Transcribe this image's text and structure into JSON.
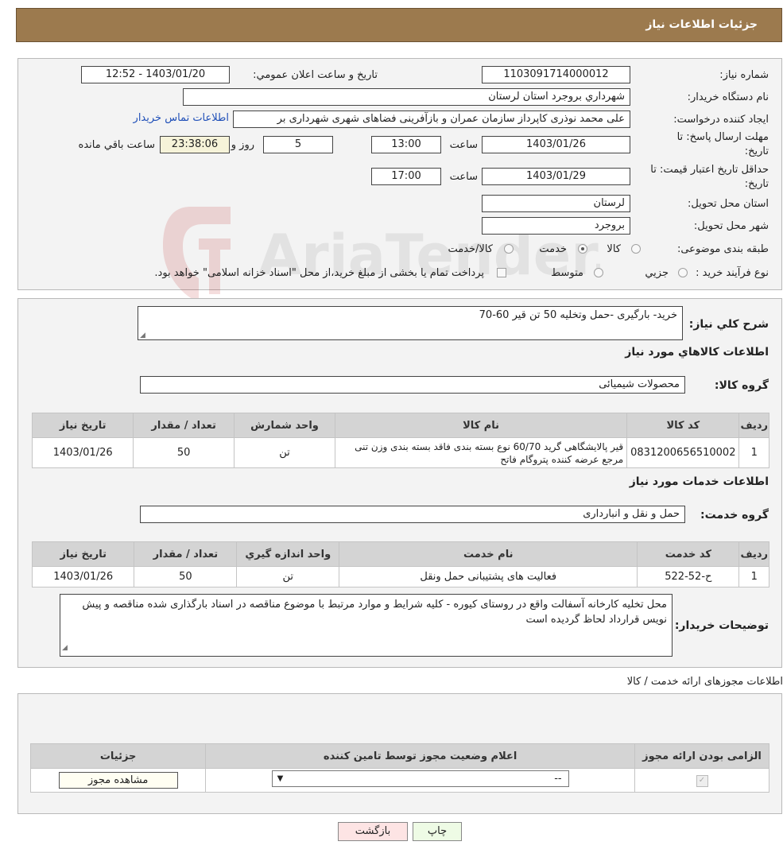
{
  "header": {
    "title": "جزئیات اطلاعات نیاز"
  },
  "need": {
    "number_label": "شماره نیاز:",
    "number": "1103091714000012",
    "announce_label": "تاریخ و ساعت اعلان عمومي:",
    "announce": "1403/01/20 - 12:52",
    "buyer_org_label": "نام دستگاه خريدار:",
    "buyer_org": "شهرداري بروجرد استان لرستان",
    "creator_label": "ايجاد کننده درخواست:",
    "creator": "علی محمد نوذری کاپرداز سازمان عمران و بازآفرینی فضاهای شهری شهرداری بر",
    "contact_link": "اطلاعات تماس خريدار",
    "reply_deadline_label_1": "مهلت ارسال پاسخ: تا",
    "reply_deadline_label_2": "تاريخ:",
    "reply_date": "1403/01/26",
    "hour_label": "ساعت",
    "reply_time": "13:00",
    "days": "5",
    "days_label": "روز و",
    "remaining": "23:38:06",
    "remaining_label": "ساعت باقي مانده",
    "price_validity_label_1": "حداقل تاريخ اعتبار قيمت: تا",
    "price_validity_label_2": "تاريخ:",
    "price_date": "1403/01/29",
    "price_time": "17:00",
    "province_label": "استان محل تحويل:",
    "province": "لرستان",
    "city_label": "شهر محل تحويل:",
    "city": "بروجرد",
    "category_label": "طبقه بندی موضوعی:",
    "category_options": [
      "کالا",
      "خدمت",
      "کالا/خدمت"
    ],
    "process_label": "نوع فرآيند خريد :",
    "process_options": [
      "جزيي",
      "متوسط"
    ],
    "process_note": "پرداخت تمام يا بخشی از مبلغ خريد،از محل \"اسناد خزانه اسلامی\" خواهد بود."
  },
  "summary": {
    "desc_label": "شرح کلي نياز:",
    "desc": "خرید- بارگیری -حمل وتخلیه 50 تن قیر 60-70",
    "goods_section": "اطلاعات کالاهاي مورد نياز",
    "goods_group_label": "گروه کالا:",
    "goods_group": "محصولات شیمیائی",
    "goods_table": {
      "headers": [
        "رديف",
        "کد کالا",
        "نام کالا",
        "واحد شمارش",
        "تعداد / مقدار",
        "تاريخ نياز"
      ],
      "rows": [
        [
          "1",
          "0831200656510002",
          "قیر پالایشگاهی گرید 60/70 نوع بسته بندی فاقد بسته بندی وزن تنی مرجع عرضه کننده پتروگام فاتح",
          "تن",
          "50",
          "1403/01/26"
        ]
      ]
    },
    "services_section": "اطلاعات خدمات مورد نياز",
    "service_group_label": "گروه خدمت:",
    "service_group": "حمل و نقل و انبارداری",
    "services_table": {
      "headers": [
        "رديف",
        "کد خدمت",
        "نام خدمت",
        "واحد اندازه گيري",
        "تعداد / مقدار",
        "تاريخ نياز"
      ],
      "rows": [
        [
          "1",
          "ح-52-522",
          "فعالیت های پشتیبانی حمل ونقل",
          "تن",
          "50",
          "1403/01/26"
        ]
      ]
    },
    "buyer_notes_label": "توضيحات خريدار:",
    "buyer_notes": "محل تخلیه کارخانه آسفالت واقع در روستای کیوره - کلیه شرایط و موارد مرتبط با موضوع مناقصه در اسناد بارگذاری شده مناقصه و پیش نویس قرارداد لحاظ گردیده است"
  },
  "permits": {
    "title": "اطلاعات مجوزهای ارائه خدمت / کالا",
    "headers": [
      "الزامی بودن ارائه مجوز",
      "اعلام وضعيت مجوز توسط تامين کننده",
      "جزئيات"
    ],
    "select_value": "--",
    "view_button": "مشاهده مجوز"
  },
  "footer": {
    "print": "چاپ",
    "back": "بازگشت"
  },
  "watermark_text": "AriaTender.neT"
}
